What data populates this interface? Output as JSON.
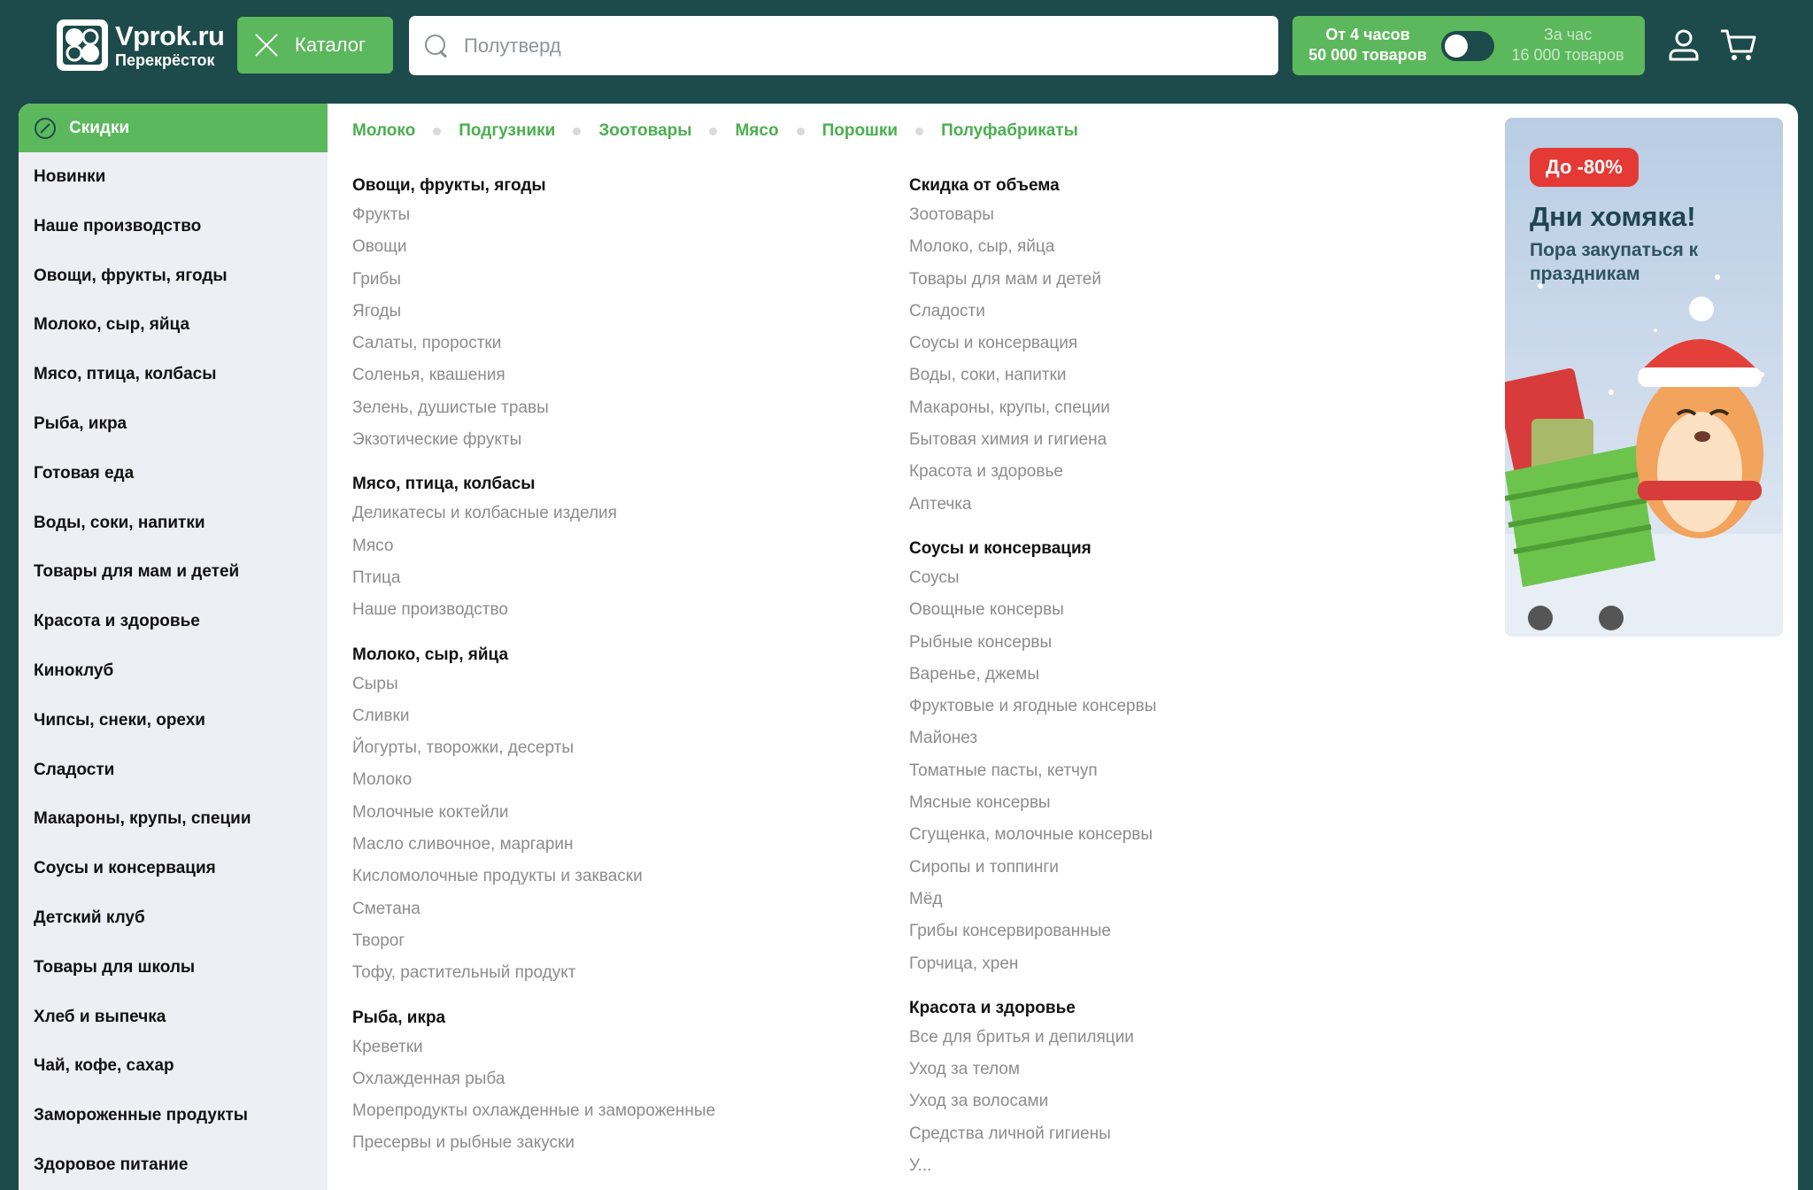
{
  "header": {
    "logo_name": "Vprok.ru",
    "logo_sub": "Перекрёсток",
    "catalog_label": "Каталог",
    "search_placeholder": "Полутверд",
    "delivery_left_line1": "От 4 часов",
    "delivery_left_line2": "50 000 товаров",
    "delivery_right_line1": "За час",
    "delivery_right_line2": "16 000 товаров",
    "accent": "#5cb85c",
    "dark": "#1d4a4a"
  },
  "sidebar": {
    "active_label": "Скидки",
    "items": [
      "Новинки",
      "Наше производство",
      "Овощи, фрукты, ягоды",
      "Молоко, сыр, яйца",
      "Мясо, птица, колбасы",
      "Рыба, икра",
      "Готовая еда",
      "Воды, соки, напитки",
      "Товары для мам и детей",
      "Красота и здоровье",
      "Киноклуб",
      "Чипсы, снеки, орехи",
      "Сладости",
      "Макароны, крупы, специи",
      "Соусы и консервация",
      "Детский клуб",
      "Товары для школы",
      "Хлеб и выпечка",
      "Чай, кофе, сахар",
      "Замороженные продукты",
      "Здоровое питание"
    ]
  },
  "quick_links": [
    "Молоко",
    "Подгузники",
    "Зоотовары",
    "Мясо",
    "Порошки",
    "Полуфабрикаты"
  ],
  "columns": {
    "left": [
      {
        "title": "Овощи, фрукты, ягоды",
        "items": [
          "Фрукты",
          "Овощи",
          "Грибы",
          "Ягоды",
          "Салаты, проростки",
          "Соленья, квашения",
          "Зелень, душистые травы",
          "Экзотические фрукты"
        ]
      },
      {
        "title": "Мясо, птица, колбасы",
        "items": [
          "Деликатесы и колбасные изделия",
          "Мясо",
          "Птица",
          "Наше производство"
        ]
      },
      {
        "title": "Молоко, сыр, яйца",
        "items": [
          "Сыры",
          "Сливки",
          "Йогурты, творожки, десерты",
          "Молоко",
          "Молочные коктейли",
          "Масло сливочное, маргарин",
          "Кисломолочные продукты и закваски",
          "Сметана",
          "Творог",
          "Тофу, растительный продукт"
        ]
      },
      {
        "title": "Рыба, икра",
        "items": [
          "Креветки",
          "Охлажденная рыба",
          "Морепродукты охлажденные и замороженные",
          "Пресервы и рыбные закуски"
        ]
      }
    ],
    "right": [
      {
        "title": "Скидка от объема",
        "items": [
          "Зоотовары",
          "Молоко, сыр, яйца",
          "Товары для мам и детей",
          "Сладости",
          "Соусы и консервация",
          "Воды, соки, напитки",
          "Макароны, крупы, специи",
          "Бытовая химия и гигиена",
          "Красота и здоровье",
          "Аптечка"
        ]
      },
      {
        "title": "Соусы и консервация",
        "items": [
          "Соусы",
          "Овощные консервы",
          "Рыбные консервы",
          "Варенье, джемы",
          "Фруктовые и ягодные консервы",
          "Майонез",
          "Томатные пасты, кетчуп",
          "Мясные консервы",
          "Сгущенка, молочные консервы",
          "Сиропы и топпинги",
          "Мёд",
          "Грибы консервированные",
          "Горчица, хрен"
        ]
      },
      {
        "title": "Красота и здоровье",
        "items": [
          "Все для бритья и депиляции",
          "Уход за телом",
          "Уход за волосами",
          "Средства личной гигиены",
          "У..."
        ]
      }
    ]
  },
  "banner": {
    "badge": "До -80%",
    "title": "Дни хомяка!",
    "subtitle": "Пора закупаться к праздникам"
  }
}
